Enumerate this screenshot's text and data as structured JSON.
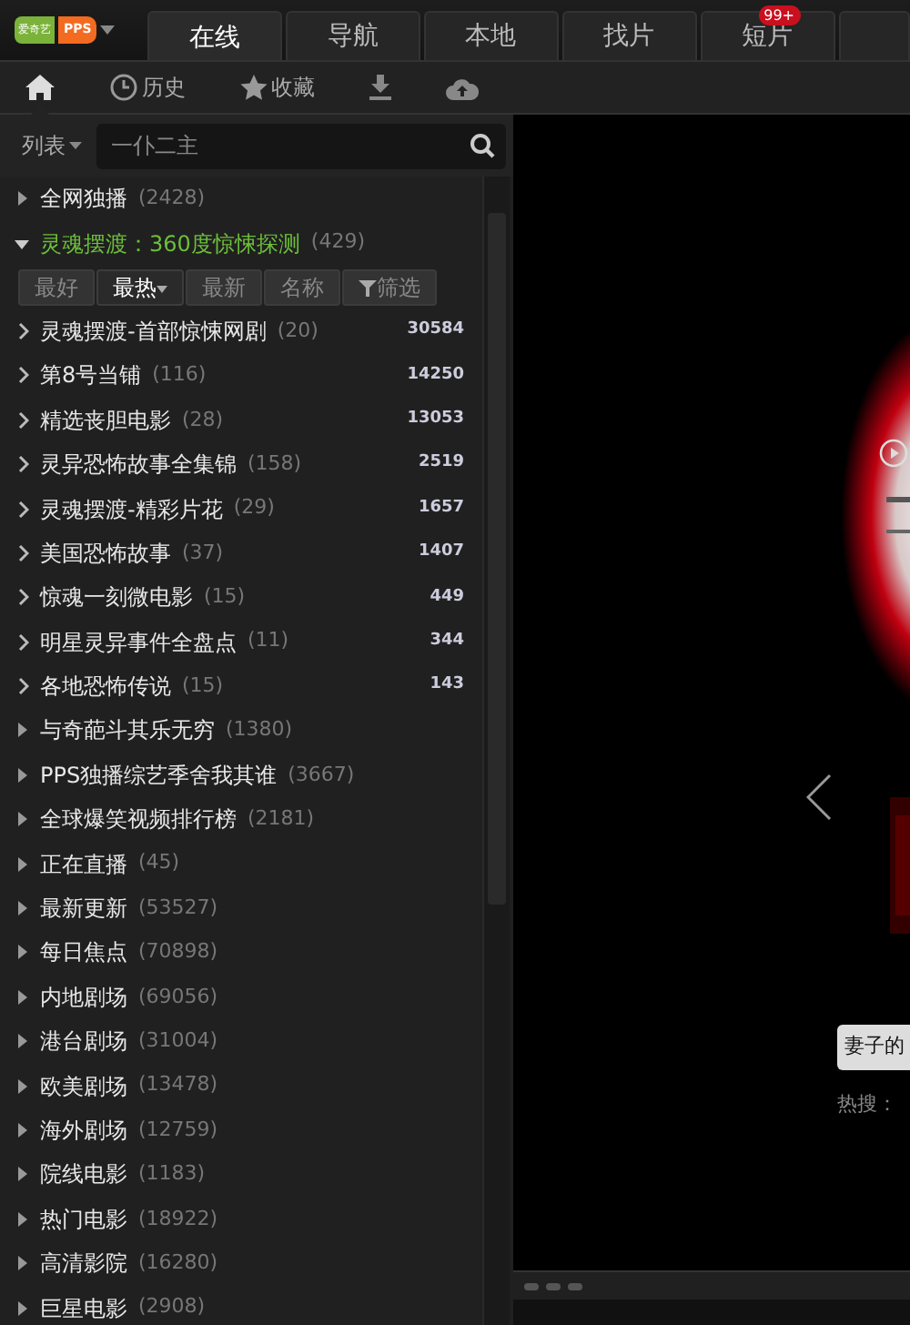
{
  "logo": {
    "left": "爱奇艺",
    "right": "PPS"
  },
  "tabs": [
    {
      "label": "在线",
      "selected": true
    },
    {
      "label": "导航",
      "selected": false
    },
    {
      "label": "本地",
      "selected": false
    },
    {
      "label": "找片",
      "selected": false
    },
    {
      "label": "短片",
      "selected": false,
      "badge": "99+"
    }
  ],
  "toolbar": [
    {
      "kind": "home",
      "selected": true
    },
    {
      "kind": "history",
      "label": "历史",
      "selected": false
    },
    {
      "kind": "favorite",
      "label": "收藏",
      "selected": false
    },
    {
      "kind": "download",
      "selected": false
    },
    {
      "kind": "cloud",
      "selected": false
    }
  ],
  "search": {
    "mode": "列表",
    "placeholder": "一仆二主"
  },
  "tree": [
    {
      "label": "全网独播",
      "count": "(2428)",
      "expanded": false
    },
    {
      "label": "灵魂摆渡：360度惊悚探测",
      "count": "(429)",
      "expanded": true,
      "sort_buttons": [
        {
          "label": "最好",
          "selected": false
        },
        {
          "label": "最热",
          "selected": true,
          "kind": "dropdown"
        },
        {
          "label": "最新",
          "selected": false
        },
        {
          "label": "名称",
          "selected": false
        },
        {
          "label": "筛选",
          "selected": false,
          "kind": "filter"
        }
      ],
      "children": [
        {
          "label": "灵魂摆渡-首部惊悚网剧",
          "count": "(20)",
          "plays": "30584"
        },
        {
          "label": "第8号当铺",
          "count": "(116)",
          "plays": "14250"
        },
        {
          "label": "精选丧胆电影",
          "count": "(28)",
          "plays": "13053"
        },
        {
          "label": "灵异恐怖故事全集锦",
          "count": "(158)",
          "plays": "2519"
        },
        {
          "label": "灵魂摆渡-精彩片花",
          "count": "(29)",
          "plays": "1657"
        },
        {
          "label": "美国恐怖故事",
          "count": "(37)",
          "plays": "1407"
        },
        {
          "label": "惊魂一刻微电影",
          "count": "(15)",
          "plays": "449"
        },
        {
          "label": "明星灵异事件全盘点",
          "count": "(11)",
          "plays": "344"
        },
        {
          "label": "各地恐怖传说",
          "count": "(15)",
          "plays": "143"
        }
      ]
    },
    {
      "label": "与奇葩斗其乐无穷",
      "count": "(1380)",
      "expanded": false
    },
    {
      "label": "PPS独播综艺季舍我其谁",
      "count": "(3667)",
      "expanded": false
    },
    {
      "label": "全球爆笑视频排行榜",
      "count": "(2181)",
      "expanded": false
    },
    {
      "label": "正在直播",
      "count": "(45)",
      "expanded": false
    },
    {
      "label": "最新更新",
      "count": "(53527)",
      "expanded": false
    },
    {
      "label": "每日焦点",
      "count": "(70898)",
      "expanded": false
    },
    {
      "label": "内地剧场",
      "count": "(69056)",
      "expanded": false
    },
    {
      "label": "港台剧场",
      "count": "(31004)",
      "expanded": false
    },
    {
      "label": "欧美剧场",
      "count": "(13478)",
      "expanded": false
    },
    {
      "label": "海外剧场",
      "count": "(12759)",
      "expanded": false
    },
    {
      "label": "院线电影",
      "count": "(1183)",
      "expanded": false
    },
    {
      "label": "热门电影",
      "count": "(18922)",
      "expanded": false
    },
    {
      "label": "高清影院",
      "count": "(16280)",
      "expanded": false
    },
    {
      "label": "巨星电影",
      "count": "(2908)",
      "expanded": false
    }
  ],
  "preview": {
    "search_value": "妻子的",
    "hot_label": "热搜："
  }
}
